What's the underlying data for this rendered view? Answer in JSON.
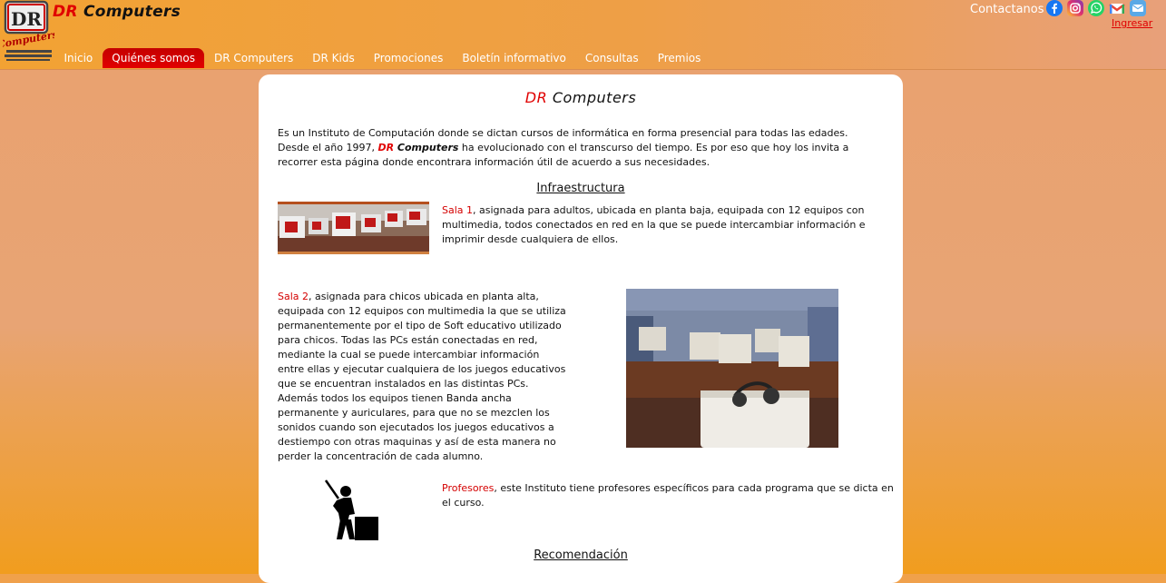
{
  "header": {
    "brand_dr": "DR",
    "brand_computers": "Computers",
    "contact_label": "Contactanos",
    "login_label": "Ingresar",
    "social_icons": [
      "facebook-icon",
      "instagram-icon",
      "whatsapp-icon",
      "gmail-icon",
      "email-icon"
    ]
  },
  "nav": {
    "items": [
      "Inicio",
      "Quiénes somos",
      "DR Computers",
      "DR Kids",
      "Promociones",
      "Boletín informativo",
      "Consultas",
      "Premios"
    ],
    "active": "Quiénes somos"
  },
  "main": {
    "title_dr": "DR",
    "title_computers": "Computers",
    "intro_line1": "Es un Instituto de Computación donde se dictan cursos de informática en forma presencial para todas las edades.",
    "intro_line2_pre": "Desde el año 1997, ",
    "intro_brand_dr": "DR",
    "intro_brand_computers": "Computers",
    "intro_line2_post": " ha evolucionado con el transcurso del tiempo. Es por eso que hoy los invita a recorrer esta página donde encontrara información útil de acuerdo a sus necesidades.",
    "section_infra": "Infraestructura",
    "sala1_label": "Sala 1",
    "sala1_text": ", asignada para adultos, ubicada en planta baja, equipada con 12 equipos con multimedia, todos conectados en red en la que se puede intercambiar información e imprimir desde cualquiera de ellos.",
    "sala2_label": "Sala 2",
    "sala2_text": ", asignada para chicos ubicada en planta alta, equipada con 12 equipos con multimedia la que se utiliza permanentemente por el tipo de Soft educativo utilizado para chicos. Todas las PCs están conectadas en red, mediante la cual se puede intercambiar información entre ellas y ejecutar cualquiera de los juegos educativos que se encuentran instalados en las distintas PCs. Además todos los equipos tienen Banda ancha permanente y auriculares, para que no se mezclen los sonidos cuando son ejecutados los juegos educativos a destiempo con otras maquinas y así de esta manera no perder la concentración de cada alumno.",
    "prof_label": "Profesores",
    "prof_text": ", este Instituto tiene profesores específicos para cada programa que se dicta en el curso.",
    "section_recom": "Recomendación"
  },
  "colors": {
    "accent_red": "#e00000",
    "header_orange": "#f2a233"
  }
}
